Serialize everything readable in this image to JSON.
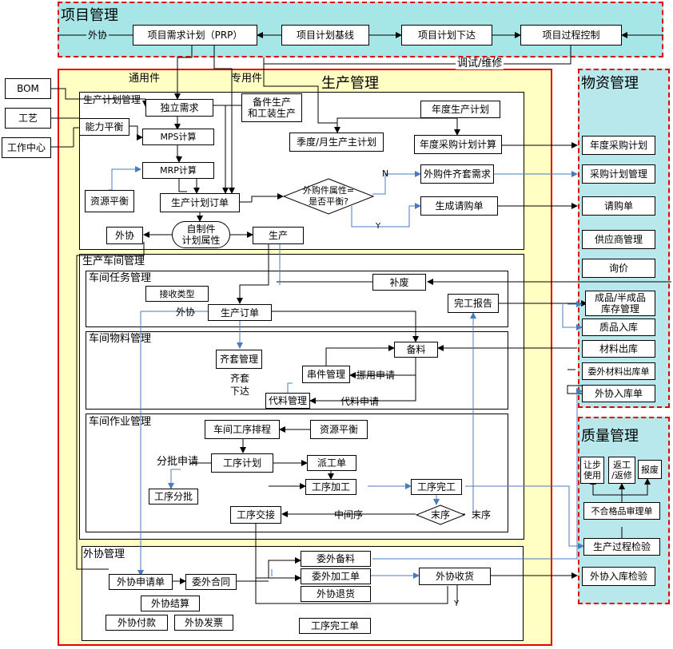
{
  "colors": {
    "project_bg": "#a6e6e6",
    "material_bg": "#b8e8ec",
    "production_bg": "#ffffc4",
    "red_dash": "#e00000",
    "red_solid": "#e60000",
    "blue_line": "#4a7bc0"
  },
  "project": {
    "title": "项目管理",
    "outsourcing_label": "外协",
    "prp": "项目需求计划（PRP）",
    "baseline": "项目计划基线",
    "release": "项目计划下达",
    "control": "项目过程控制",
    "debug_label": "调试/维修"
  },
  "inputs": {
    "bom": "BOM",
    "process": "工艺",
    "workcenter": "工作中心"
  },
  "production": {
    "title": "生产管理",
    "general_parts": "通用件",
    "special_parts": "专用件"
  },
  "planning": {
    "title": "生产计划管理",
    "independent_demand": "独立需求",
    "spare_parts": "备件生产\n和工装生产",
    "annual_plan": "年度生产计划",
    "capacity_balance": "能力平衡",
    "mps": "MPS计算",
    "quarterly_plan": "季度/月生产主计划",
    "annual_purchase_calc": "年度采购计划计算",
    "mrp": "MRP计算",
    "resource_balance": "资源平衡",
    "plan_order": "生产计划订单",
    "decision": "外购件属性=\n是否平衡?",
    "n_label": "N",
    "y_label": "Y",
    "purchase_kit": "外购件齐套需求",
    "generate_pr": "生成请购单",
    "outsourcing": "外协",
    "self_made": "自制件\n计划属性",
    "produce": "生产"
  },
  "workshop": {
    "title": "生产车间管理",
    "task_title": "车间任务管理",
    "receive_type": "接收类型",
    "supplement": "补废",
    "completion_report": "完工报告",
    "outsource_label": "外协",
    "production_order": "生产订单",
    "material_title": "车间物料管理",
    "kit_management": "齐套管理",
    "kit_release": "齐套\n下达",
    "prepare_material": "备料",
    "borrow_management": "串件管理",
    "borrow_request": "挪用申请",
    "substitute_management": "代料管理",
    "substitute_request": "代料申请",
    "operation_title": "车间作业管理",
    "sequencing": "车间工序排程",
    "resource_balance": "资源平衡",
    "split_request": "分批申请",
    "process_plan": "工序计划",
    "dispatch": "派工单",
    "process_split": "工序分批",
    "processing": "工序加工",
    "process_complete": "工序完工",
    "handover": "工序交接",
    "middle_process": "中间序",
    "last_process_q": "末序",
    "last_process": "末序"
  },
  "outsourcing": {
    "title": "外协管理",
    "request": "外协申请单",
    "contract": "委外合同",
    "material_prep": "委外备料",
    "processing_order": "委外加工单",
    "return_goods": "外协退货",
    "receiving": "外协收货",
    "settlement": "外协结算",
    "payment": "外协付款",
    "invoice": "外协发票",
    "process_complete_order": "工序完工单",
    "y_label": "Y"
  },
  "material": {
    "title": "物资管理",
    "annual_purchase": "年度采购计划",
    "purchase_plan": "采购计划管理",
    "purchase_request": "请购单",
    "supplier": "供应商管理",
    "inquiry": "询价",
    "finished_stock": "成品/半成品\n库存管理",
    "quality_in": "质品入库",
    "material_out": "材料出库",
    "outsource_out": "委外材料出库单",
    "outsource_in": "外协入库单"
  },
  "quality": {
    "title": "质量管理",
    "concession": "让步\n使用",
    "rework": "返工\n/返修",
    "scrap": "报废",
    "nonconforming": "不合格品审理单",
    "process_inspection": "生产过程检验",
    "outsource_inspection": "外协入库检验"
  }
}
